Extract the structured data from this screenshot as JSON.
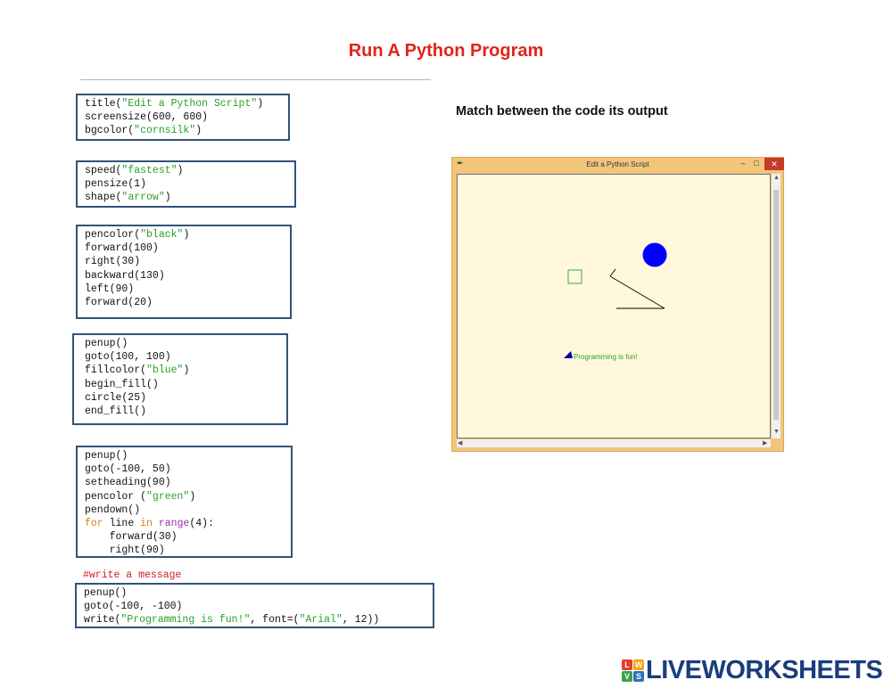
{
  "page": {
    "title": "Run A Python Program",
    "instruction": "Match between the code its output"
  },
  "code_blocks": [
    {
      "lines": [
        [
          {
            "t": "title("
          },
          {
            "t": "\"Edit a Python Script\"",
            "c": "str"
          },
          {
            "t": ")"
          }
        ],
        [
          {
            "t": "screensize(600, 600)"
          }
        ],
        [
          {
            "t": "bgcolor("
          },
          {
            "t": "\"cornsilk\"",
            "c": "str"
          },
          {
            "t": ")"
          }
        ]
      ]
    },
    {
      "lines": [
        [
          {
            "t": "speed("
          },
          {
            "t": "\"fastest\"",
            "c": "str"
          },
          {
            "t": ")"
          }
        ],
        [
          {
            "t": "pensize(1)"
          }
        ],
        [
          {
            "t": "shape("
          },
          {
            "t": "\"arrow\"",
            "c": "str"
          },
          {
            "t": ")"
          }
        ]
      ]
    },
    {
      "lines": [
        [
          {
            "t": "pencolor("
          },
          {
            "t": "\"black\"",
            "c": "str"
          },
          {
            "t": ")"
          }
        ],
        [
          {
            "t": "forward(100)"
          }
        ],
        [
          {
            "t": "right(30)"
          }
        ],
        [
          {
            "t": "backward(130)"
          }
        ],
        [
          {
            "t": "left(90)"
          }
        ],
        [
          {
            "t": "forward(20)"
          }
        ]
      ]
    },
    {
      "lines": [
        [
          {
            "t": "penup()"
          }
        ],
        [
          {
            "t": "goto(100, 100)"
          }
        ],
        [
          {
            "t": "fillcolor("
          },
          {
            "t": "\"blue\"",
            "c": "str"
          },
          {
            "t": ")"
          }
        ],
        [
          {
            "t": "begin_fill()"
          }
        ],
        [
          {
            "t": "circle(25)"
          }
        ],
        [
          {
            "t": "end_fill()"
          }
        ]
      ]
    },
    {
      "lines": [
        [
          {
            "t": "penup()"
          }
        ],
        [
          {
            "t": "goto(-100, 50)"
          }
        ],
        [
          {
            "t": "setheading(90)"
          }
        ],
        [
          {
            "t": "pencolor ("
          },
          {
            "t": "\"green\"",
            "c": "str"
          },
          {
            "t": ")"
          }
        ],
        [
          {
            "t": "pendown()"
          }
        ],
        [
          {
            "t": "for",
            "c": "kw"
          },
          {
            "t": " line "
          },
          {
            "t": "in",
            "c": "kw"
          },
          {
            "t": " "
          },
          {
            "t": "range",
            "c": "bi"
          },
          {
            "t": "(4):"
          }
        ],
        [
          {
            "t": "    forward(30)"
          }
        ],
        [
          {
            "t": "    right(90)"
          }
        ]
      ]
    },
    {
      "lines": [
        [
          {
            "t": "penup()"
          }
        ],
        [
          {
            "t": "goto(-100, -100)"
          }
        ],
        [
          {
            "t": "write("
          },
          {
            "t": "\"Programming is fun!\"",
            "c": "str"
          },
          {
            "t": ", font=("
          },
          {
            "t": "\"Arial\"",
            "c": "str"
          },
          {
            "t": ", 12))"
          }
        ]
      ]
    }
  ],
  "comment": "#write a message",
  "window": {
    "title": "Edit a Python Script",
    "feather_icon": "✒",
    "minimize_icon": "–",
    "maximize_icon": "□",
    "close_icon": "✕",
    "canvas_message": "Programming is fun!",
    "colors": {
      "background": "#fff8dc",
      "circle": "#0000ff",
      "square": "#2aa02a",
      "lines": "#000000",
      "arrow": "#0000aa"
    }
  },
  "logo": {
    "tiles": [
      "L",
      "W",
      "V",
      "S"
    ],
    "text": "LIVEWORKSHEETS"
  }
}
